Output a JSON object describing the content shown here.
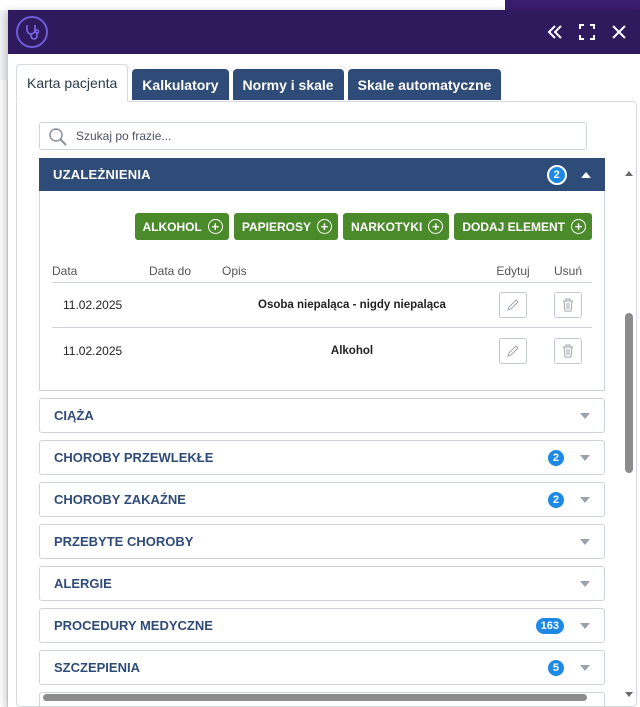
{
  "tabs": [
    {
      "label": "Karta pacjenta",
      "active": true
    },
    {
      "label": "Kalkulatory",
      "active": false
    },
    {
      "label": "Normy i skale",
      "active": false
    },
    {
      "label": "Skale automatyczne",
      "active": false
    }
  ],
  "search": {
    "placeholder": "Szukaj po frazie..."
  },
  "open_section": {
    "title": "UZALEŻNIENIA",
    "count": "2",
    "add_buttons": [
      "ALKOHOL",
      "PAPIEROSY",
      "NARKOTYKI",
      "DODAJ ELEMENT"
    ],
    "columns": {
      "data": "Data",
      "data_do": "Data do",
      "opis": "Opis",
      "edit": "Edytuj",
      "delete": "Usuń"
    },
    "rows": [
      {
        "data": "11.02.2025",
        "data_do": "",
        "opis": "Osoba niepaląca - nigdy niepaląca"
      },
      {
        "data": "11.02.2025",
        "data_do": "",
        "opis": "Alkohol"
      }
    ]
  },
  "sections": [
    {
      "title": "CIĄŻA",
      "count": ""
    },
    {
      "title": "CHOROBY PRZEWLEKŁE",
      "count": "2"
    },
    {
      "title": "CHOROBY ZAKAŹNE",
      "count": "2"
    },
    {
      "title": "PRZEBYTE CHOROBY",
      "count": ""
    },
    {
      "title": "ALERGIE",
      "count": ""
    },
    {
      "title": "PROCEDURY MEDYCZNE",
      "count": "163"
    },
    {
      "title": "SZCZEPIENIA",
      "count": "5"
    }
  ],
  "colors": {
    "header_bg": "#2e1a5c",
    "tab_bg": "#2f4b78",
    "add_button": "#4a8a2a",
    "badge": "#1e88e5"
  }
}
